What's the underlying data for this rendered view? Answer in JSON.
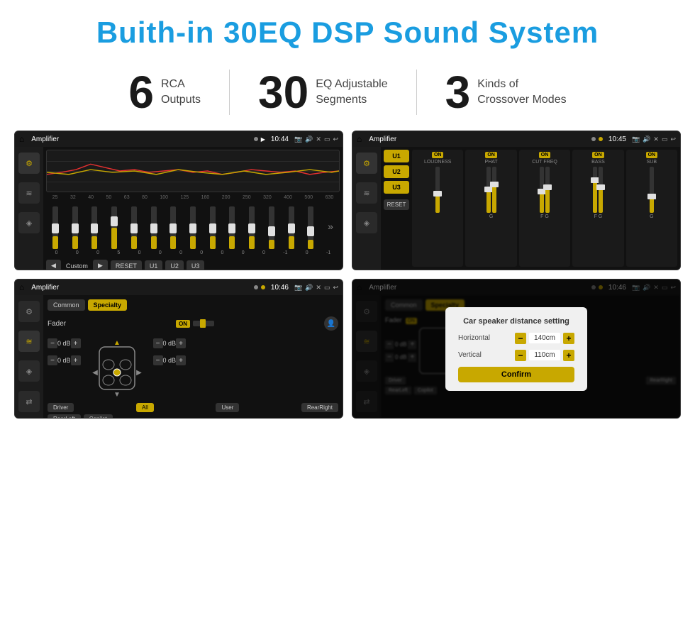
{
  "page": {
    "title": "Buith-in 30EQ DSP Sound System"
  },
  "stats": [
    {
      "number": "6",
      "label": "RCA\nOutputs"
    },
    {
      "number": "30",
      "label": "EQ Adjustable\nSegments"
    },
    {
      "number": "3",
      "label": "Kinds of\nCrossover Modes"
    }
  ],
  "screenshots": [
    {
      "id": "eq",
      "statusBar": {
        "title": "Amplifier",
        "time": "10:44"
      },
      "type": "equalizer"
    },
    {
      "id": "crossover",
      "statusBar": {
        "title": "Amplifier",
        "time": "10:45"
      },
      "type": "crossover"
    },
    {
      "id": "fader",
      "statusBar": {
        "title": "Amplifier",
        "time": "10:46"
      },
      "type": "fader"
    },
    {
      "id": "distance",
      "statusBar": {
        "title": "Amplifier",
        "time": "10:46"
      },
      "type": "distance-dialog"
    }
  ],
  "eq": {
    "freqLabels": [
      "25",
      "32",
      "40",
      "50",
      "63",
      "80",
      "100",
      "125",
      "160",
      "200",
      "250",
      "320",
      "400",
      "500",
      "630"
    ],
    "sliderValues": [
      0,
      0,
      0,
      5,
      0,
      0,
      0,
      0,
      0,
      0,
      0,
      -1,
      0,
      -1
    ],
    "presetLabel": "Custom",
    "buttons": [
      "RESET",
      "U1",
      "U2",
      "U3"
    ]
  },
  "crossover": {
    "channels": [
      "LOUDNESS",
      "PHAT",
      "CUT FREQ",
      "BASS",
      "SUB"
    ],
    "uButtons": [
      "U1",
      "U2",
      "U3"
    ]
  },
  "fader": {
    "tabs": [
      "Common",
      "Specialty"
    ],
    "activeTab": "Specialty",
    "faderLabel": "Fader",
    "faderOn": "ON",
    "rows": [
      {
        "label": "Driver",
        "value": "0 dB"
      },
      {
        "label": "Copilot",
        "value": "0 dB"
      },
      {
        "label": "RearLeft",
        "value": "0 dB"
      },
      {
        "label": "RearRight",
        "value": "0 dB"
      }
    ],
    "bottomButtons": [
      "Driver",
      "All",
      "User",
      "RearRight",
      "RearLeft",
      "Copilot"
    ]
  },
  "dialog": {
    "title": "Car speaker distance setting",
    "horizontal": {
      "label": "Horizontal",
      "value": "140cm"
    },
    "vertical": {
      "label": "Vertical",
      "value": "110cm"
    },
    "confirmLabel": "Confirm"
  },
  "colors": {
    "accent": "#c8a800",
    "blue": "#1a9de0",
    "dark": "#1a1a1a",
    "text": "#ffffff"
  }
}
